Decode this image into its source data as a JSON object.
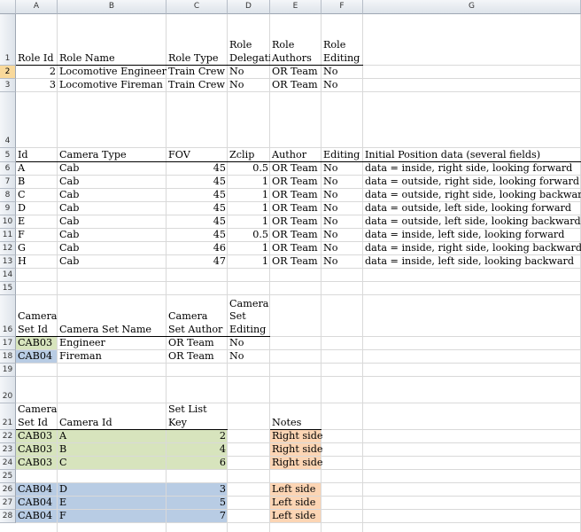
{
  "columns": [
    "A",
    "B",
    "C",
    "D",
    "E",
    "F",
    "G"
  ],
  "colors": {
    "green": "#d7e4bd",
    "blue": "#b8cce4",
    "orange": "#fcd5b4",
    "row_selected": "#f9d99b"
  },
  "rows": [
    {
      "num": "1",
      "cells": {
        "A": "Role Id",
        "B": "Role Name",
        "C": "Role Type",
        "D": "Role Delegation",
        "E": "Role Authors",
        "F": "Role Editing"
      }
    },
    {
      "num": "2",
      "cells": {
        "A": "2",
        "B": "Locomotive Engineer",
        "C": "Train Crew",
        "D": "No",
        "E": "OR Team",
        "F": "No"
      }
    },
    {
      "num": "3",
      "cells": {
        "A": "3",
        "B": "Locomotive Fireman",
        "C": "Train Crew",
        "D": "No",
        "E": "OR Team",
        "F": "No"
      }
    },
    {
      "num": "4",
      "cells": {}
    },
    {
      "num": "5",
      "cells": {
        "A": "Camera Id",
        "B": "Camera Type",
        "C": "Camera FOV",
        "D": "Camera Zclip",
        "E": "Camera Author",
        "F": "Camera Editing",
        "G": "Initial Position data (several fields)"
      }
    },
    {
      "num": "6",
      "cells": {
        "A": "A",
        "B": "Cab",
        "C": "45",
        "D": "0.5",
        "E": "OR Team",
        "F": "No",
        "G": "data = inside, right side, looking forward"
      }
    },
    {
      "num": "7",
      "cells": {
        "A": "B",
        "B": "Cab",
        "C": "45",
        "D": "1",
        "E": "OR Team",
        "F": "No",
        "G": "data = outside, right side, looking forward"
      }
    },
    {
      "num": "8",
      "cells": {
        "A": "C",
        "B": "Cab",
        "C": "45",
        "D": "1",
        "E": "OR Team",
        "F": "No",
        "G": "data = outside, right side, looking backward"
      }
    },
    {
      "num": "9",
      "cells": {
        "A": "D",
        "B": "Cab",
        "C": "45",
        "D": "1",
        "E": "OR Team",
        "F": "No",
        "G": "data = outside, left side, looking forward"
      }
    },
    {
      "num": "10",
      "cells": {
        "A": "E",
        "B": "Cab",
        "C": "45",
        "D": "1",
        "E": "OR Team",
        "F": "No",
        "G": "data = outside, left side, looking backward"
      }
    },
    {
      "num": "11",
      "cells": {
        "A": "F",
        "B": "Cab",
        "C": "45",
        "D": "0.5",
        "E": "OR Team",
        "F": "No",
        "G": "data = inside, left side, looking forward"
      }
    },
    {
      "num": "12",
      "cells": {
        "A": "G",
        "B": "Cab",
        "C": "46",
        "D": "1",
        "E": "OR Team",
        "F": "No",
        "G": "data = inside, right side, looking backward"
      }
    },
    {
      "num": "13",
      "cells": {
        "A": "H",
        "B": "Cab",
        "C": "47",
        "D": "1",
        "E": "OR Team",
        "F": "No",
        "G": "data = inside, left side, looking backward"
      }
    },
    {
      "num": "14",
      "cells": {}
    },
    {
      "num": "15",
      "cells": {}
    },
    {
      "num": "16",
      "cells": {
        "A": "Camera Set Id",
        "B": "Camera Set Name",
        "C": "Camera Set Author",
        "D": "Camera Set Editing"
      }
    },
    {
      "num": "17",
      "cells": {
        "A": "CAB03",
        "B": "Engineer",
        "C": "OR Team",
        "D": "No"
      }
    },
    {
      "num": "18",
      "cells": {
        "A": "CAB04",
        "B": "Fireman",
        "C": "OR Team",
        "D": "No"
      }
    },
    {
      "num": "19",
      "cells": {}
    },
    {
      "num": "20",
      "cells": {}
    },
    {
      "num": "21",
      "cells": {
        "A": "Camera Set Id",
        "B": "Camera Id",
        "C": "Camera Set List Key",
        "E": "Notes"
      }
    },
    {
      "num": "22",
      "cells": {
        "A": "CAB03",
        "B": "A",
        "C": "2",
        "E": "Right side"
      }
    },
    {
      "num": "23",
      "cells": {
        "A": "CAB03",
        "B": "B",
        "C": "4",
        "E": "Right side"
      }
    },
    {
      "num": "24",
      "cells": {
        "A": "CAB03",
        "B": "C",
        "C": "6",
        "E": "Right side"
      }
    },
    {
      "num": "25",
      "cells": {}
    },
    {
      "num": "26",
      "cells": {
        "A": "CAB04",
        "B": "D",
        "C": "3",
        "E": "Left side"
      }
    },
    {
      "num": "27",
      "cells": {
        "A": "CAB04",
        "B": "E",
        "C": "5",
        "E": "Left side"
      }
    },
    {
      "num": "28",
      "cells": {
        "A": "CAB04",
        "B": "F",
        "C": "7",
        "E": "Left side"
      }
    }
  ]
}
